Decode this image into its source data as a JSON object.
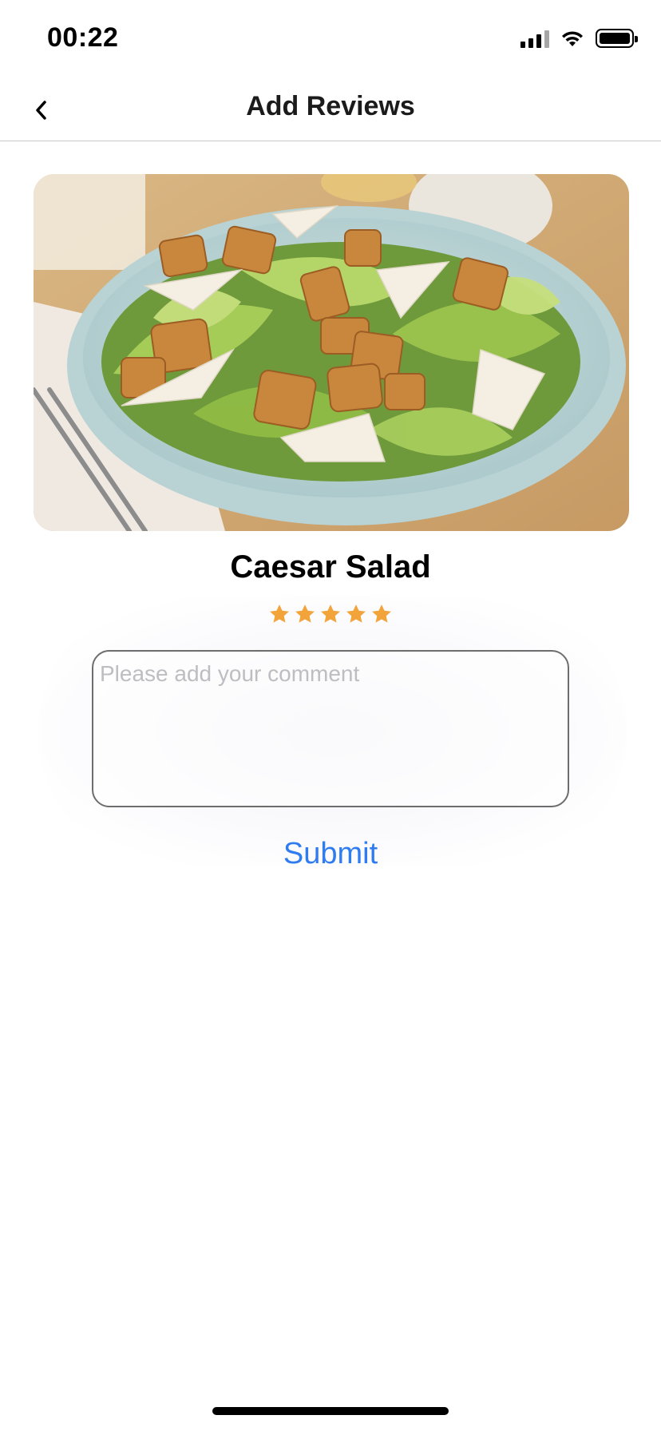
{
  "status_bar": {
    "time": "00:22"
  },
  "header": {
    "title": "Add Reviews"
  },
  "dish": {
    "name": "Caesar Salad",
    "rating": 5,
    "rating_max": 5
  },
  "review_form": {
    "comment_placeholder": "Please add your comment",
    "comment_value": "",
    "submit_label": "Submit"
  },
  "colors": {
    "accent": "#2f7cf0",
    "star": "#f2a33a"
  }
}
